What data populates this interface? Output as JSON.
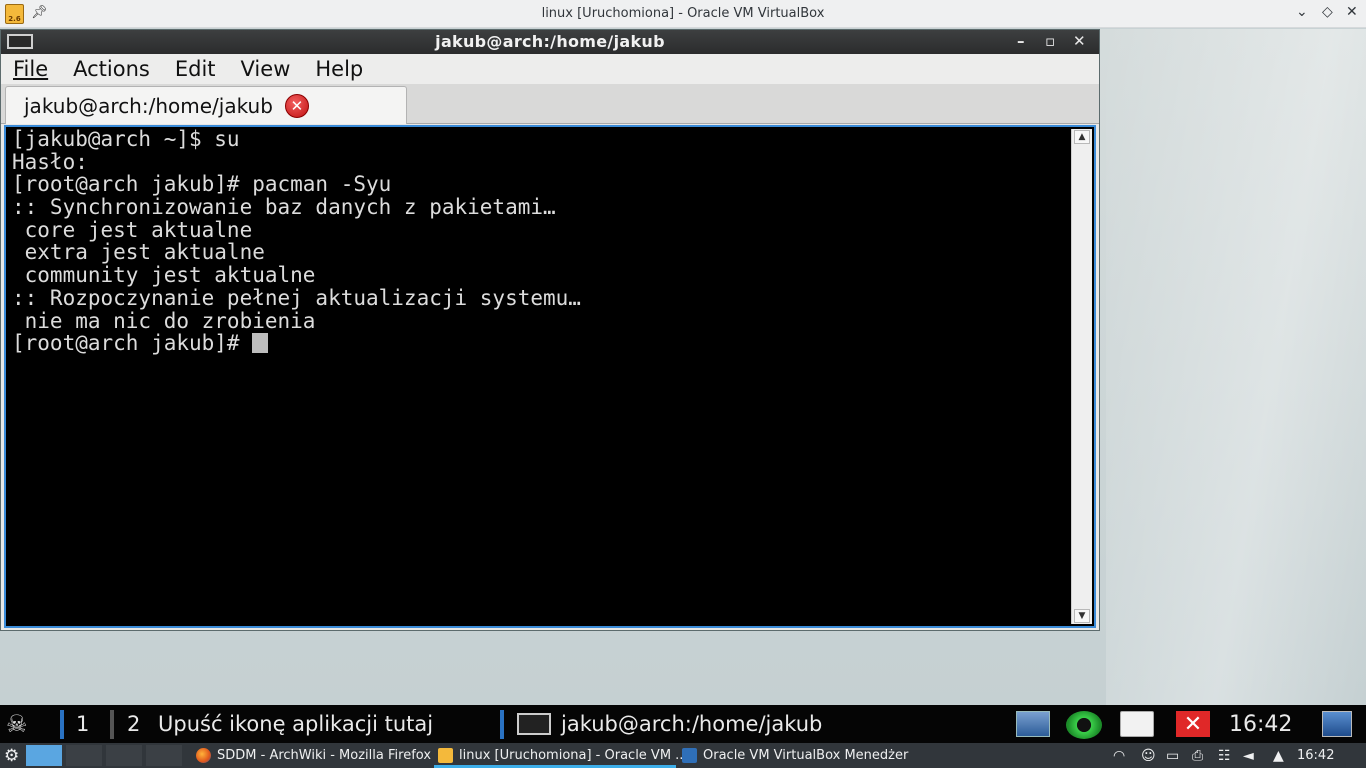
{
  "host": {
    "window_title": "linux [Uruchomiona] - Oracle VM VirtualBox",
    "app_icon_label": "2.6"
  },
  "terminal": {
    "title": "jakub@arch:/home/jakub",
    "menu": [
      "File",
      "Actions",
      "Edit",
      "View",
      "Help"
    ],
    "tab_label": "jakub@arch:/home/jakub",
    "lines": [
      "[jakub@arch ~]$ su",
      "Hasło:",
      "[root@arch jakub]# pacman -Syu",
      ":: Synchronizowanie baz danych z pakietami…",
      " core jest aktualne",
      " extra jest aktualne",
      " community jest aktualne",
      ":: Rozpoczynanie pełnej aktualizacji systemu…",
      " nie ma nic do zrobienia",
      "[root@arch jakub]# "
    ]
  },
  "guest_panel": {
    "desktop_1": "1",
    "desktop_2": "2",
    "drop_hint": "Upuść ikonę aplikacji tutaj",
    "task_label": "jakub@arch:/home/jakub",
    "clock": "16:42"
  },
  "host_taskbar": {
    "tasks": [
      "SDDM - ArchWiki - Mozilla Firefox",
      "linux [Uruchomiona] - Oracle VM ...",
      "Oracle VM VirtualBox Menedżer"
    ],
    "clock": "16:42"
  },
  "colors": {
    "terminal_bg": "#000000",
    "terminal_fg": "#dcdcdc",
    "focus_border": "#3a8bd8",
    "host_taskbar_bg": "#31363b",
    "accent": "#3daee9"
  }
}
